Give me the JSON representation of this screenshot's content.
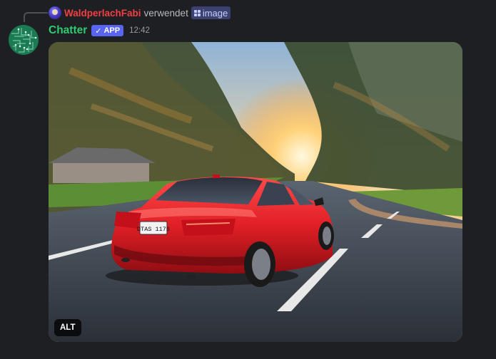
{
  "reply": {
    "username": "WaldperlachFabi",
    "verb": "verwendet",
    "command": "image"
  },
  "message": {
    "username": "Chatter",
    "app_badge": "APP",
    "timestamp": "12:42"
  },
  "attachment": {
    "alt_label": "ALT",
    "plate_text": "DTAS 1176",
    "icon": "photo-of-red-car"
  },
  "colors": {
    "reply_user": "#f23f43",
    "bot_user": "#2ecc71",
    "app_badge": "#5865f2",
    "background": "#1e1f22"
  }
}
